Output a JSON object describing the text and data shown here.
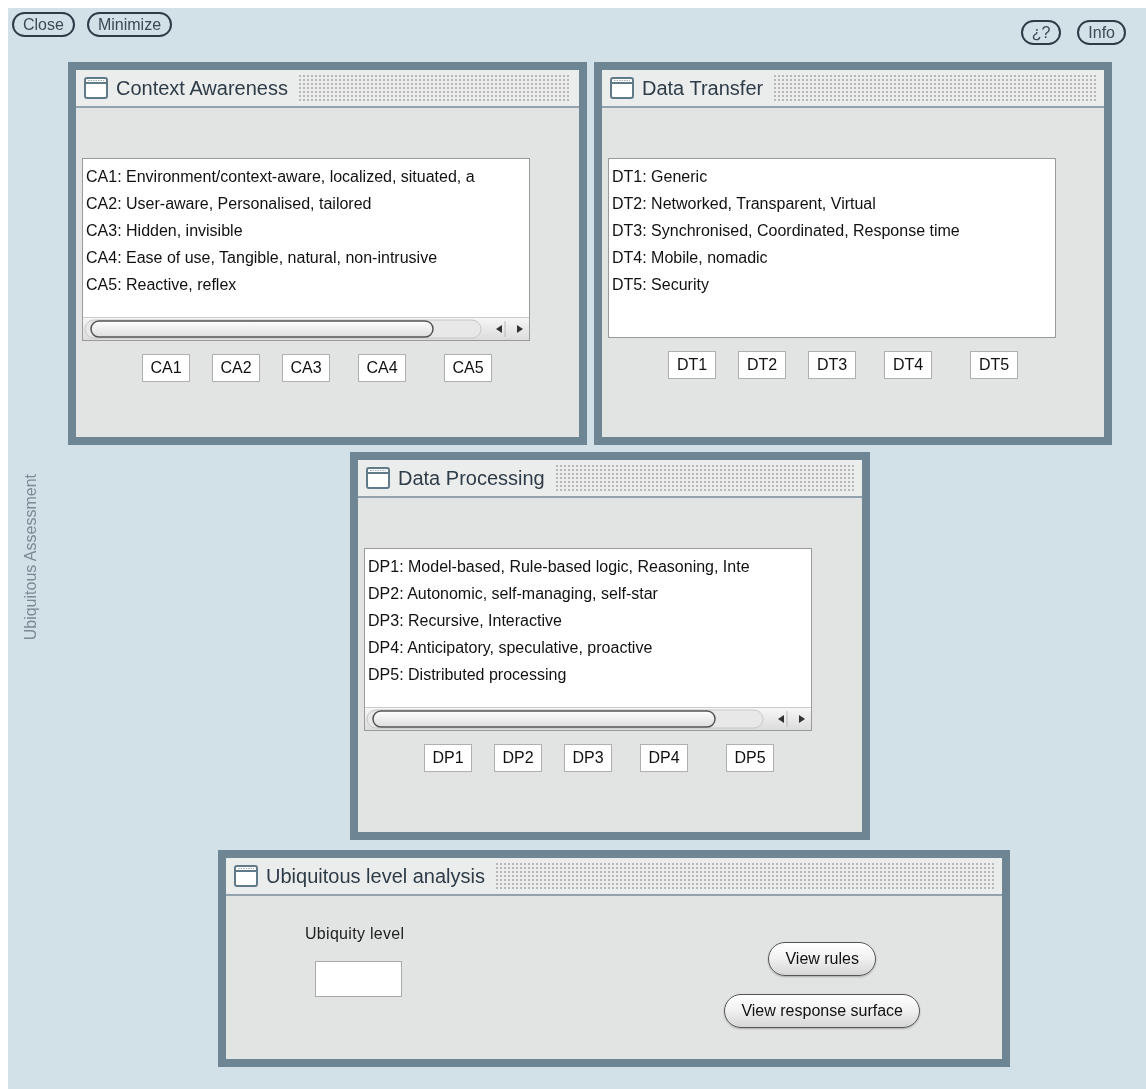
{
  "top_left_buttons": [
    "Close",
    "Minimize"
  ],
  "top_right_buttons": [
    "¿?",
    "Info"
  ],
  "side_label": "Ubiquitous Assessment",
  "panels": [
    {
      "kind": "list",
      "title": "Context Awareness",
      "horizontal_scrollbar": true,
      "items": [
        "CA1: Environment/context-aware, localized, situated, a",
        "CA2: User-aware, Personalised, tailored",
        "CA3: Hidden, invisible",
        "CA4: Ease of use, Tangible, natural, non-intrusive",
        "CA5: Reactive, reflex"
      ],
      "codes": [
        "CA1",
        "CA2",
        "CA3",
        "CA4",
        "CA5"
      ]
    },
    {
      "kind": "list",
      "title": "Data Transfer",
      "horizontal_scrollbar": false,
      "items": [
        "DT1: Generic",
        "DT2: Networked, Transparent, Virtual",
        "DT3: Synchronised, Coordinated, Response time",
        "DT4: Mobile, nomadic",
        "DT5: Security"
      ],
      "codes": [
        "DT1",
        "DT2",
        "DT3",
        "DT4",
        "DT5"
      ]
    },
    {
      "kind": "list",
      "title": "Data Processing",
      "horizontal_scrollbar": true,
      "items": [
        "DP1: Model-based, Rule-based logic, Reasoning, Inte",
        "DP2: Autonomic, self-managing, self-star",
        "DP3: Recursive, Interactive",
        "DP4: Anticipatory, speculative, proactive",
        "DP5: Distributed processing"
      ],
      "codes": [
        "DP1",
        "DP2",
        "DP3",
        "DP4",
        "DP5"
      ]
    },
    {
      "kind": "analysis",
      "title": "Ubiquitous level analysis",
      "field_label": "Ubiquity level",
      "buttons": [
        "View rules",
        "View response surface"
      ]
    }
  ]
}
